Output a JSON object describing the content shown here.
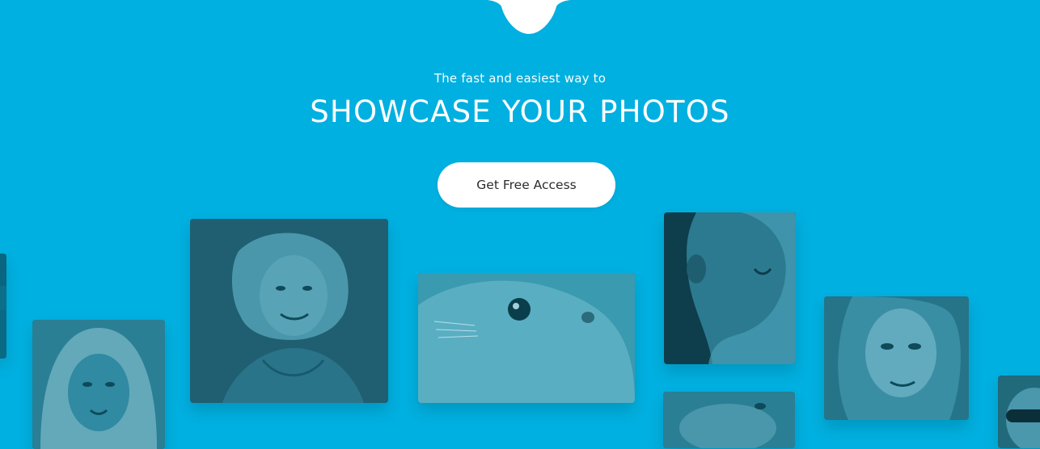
{
  "hero": {
    "tagline": "The fast and easiest way to",
    "headline": "SHOWCASE YOUR PHOTOS",
    "cta_label": "Get Free Access"
  },
  "colors": {
    "background": "#00b0e0",
    "button_background": "#ffffff",
    "button_text": "#2c2c2c",
    "photo_tint": "#0a6f8b"
  },
  "gallery": {
    "photos": [
      {
        "name": "partial-photo-left-edge",
        "subject": "person"
      },
      {
        "name": "woman-in-knit-hood",
        "subject": "person"
      },
      {
        "name": "smiling-woman-curly-hair",
        "subject": "person"
      },
      {
        "name": "seal-closeup",
        "subject": "animal"
      },
      {
        "name": "woman-side-profile",
        "subject": "person"
      },
      {
        "name": "animal-partial-bottom",
        "subject": "animal"
      },
      {
        "name": "woman-long-hair",
        "subject": "person"
      },
      {
        "name": "person-with-sunglasses-partial",
        "subject": "person"
      }
    ]
  }
}
